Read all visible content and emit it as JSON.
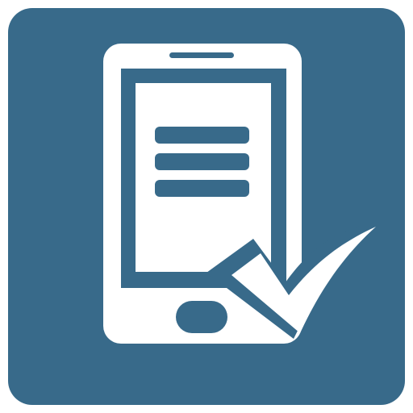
{
  "icon": {
    "name": "mobile-checklist-app-icon",
    "depicts": [
      "phone-icon",
      "list-lines-icon",
      "checkmark-icon"
    ],
    "colors": {
      "background_tile": "#386A8A",
      "foreground": "#FFFFFF",
      "page": "#FFFFFF"
    }
  }
}
